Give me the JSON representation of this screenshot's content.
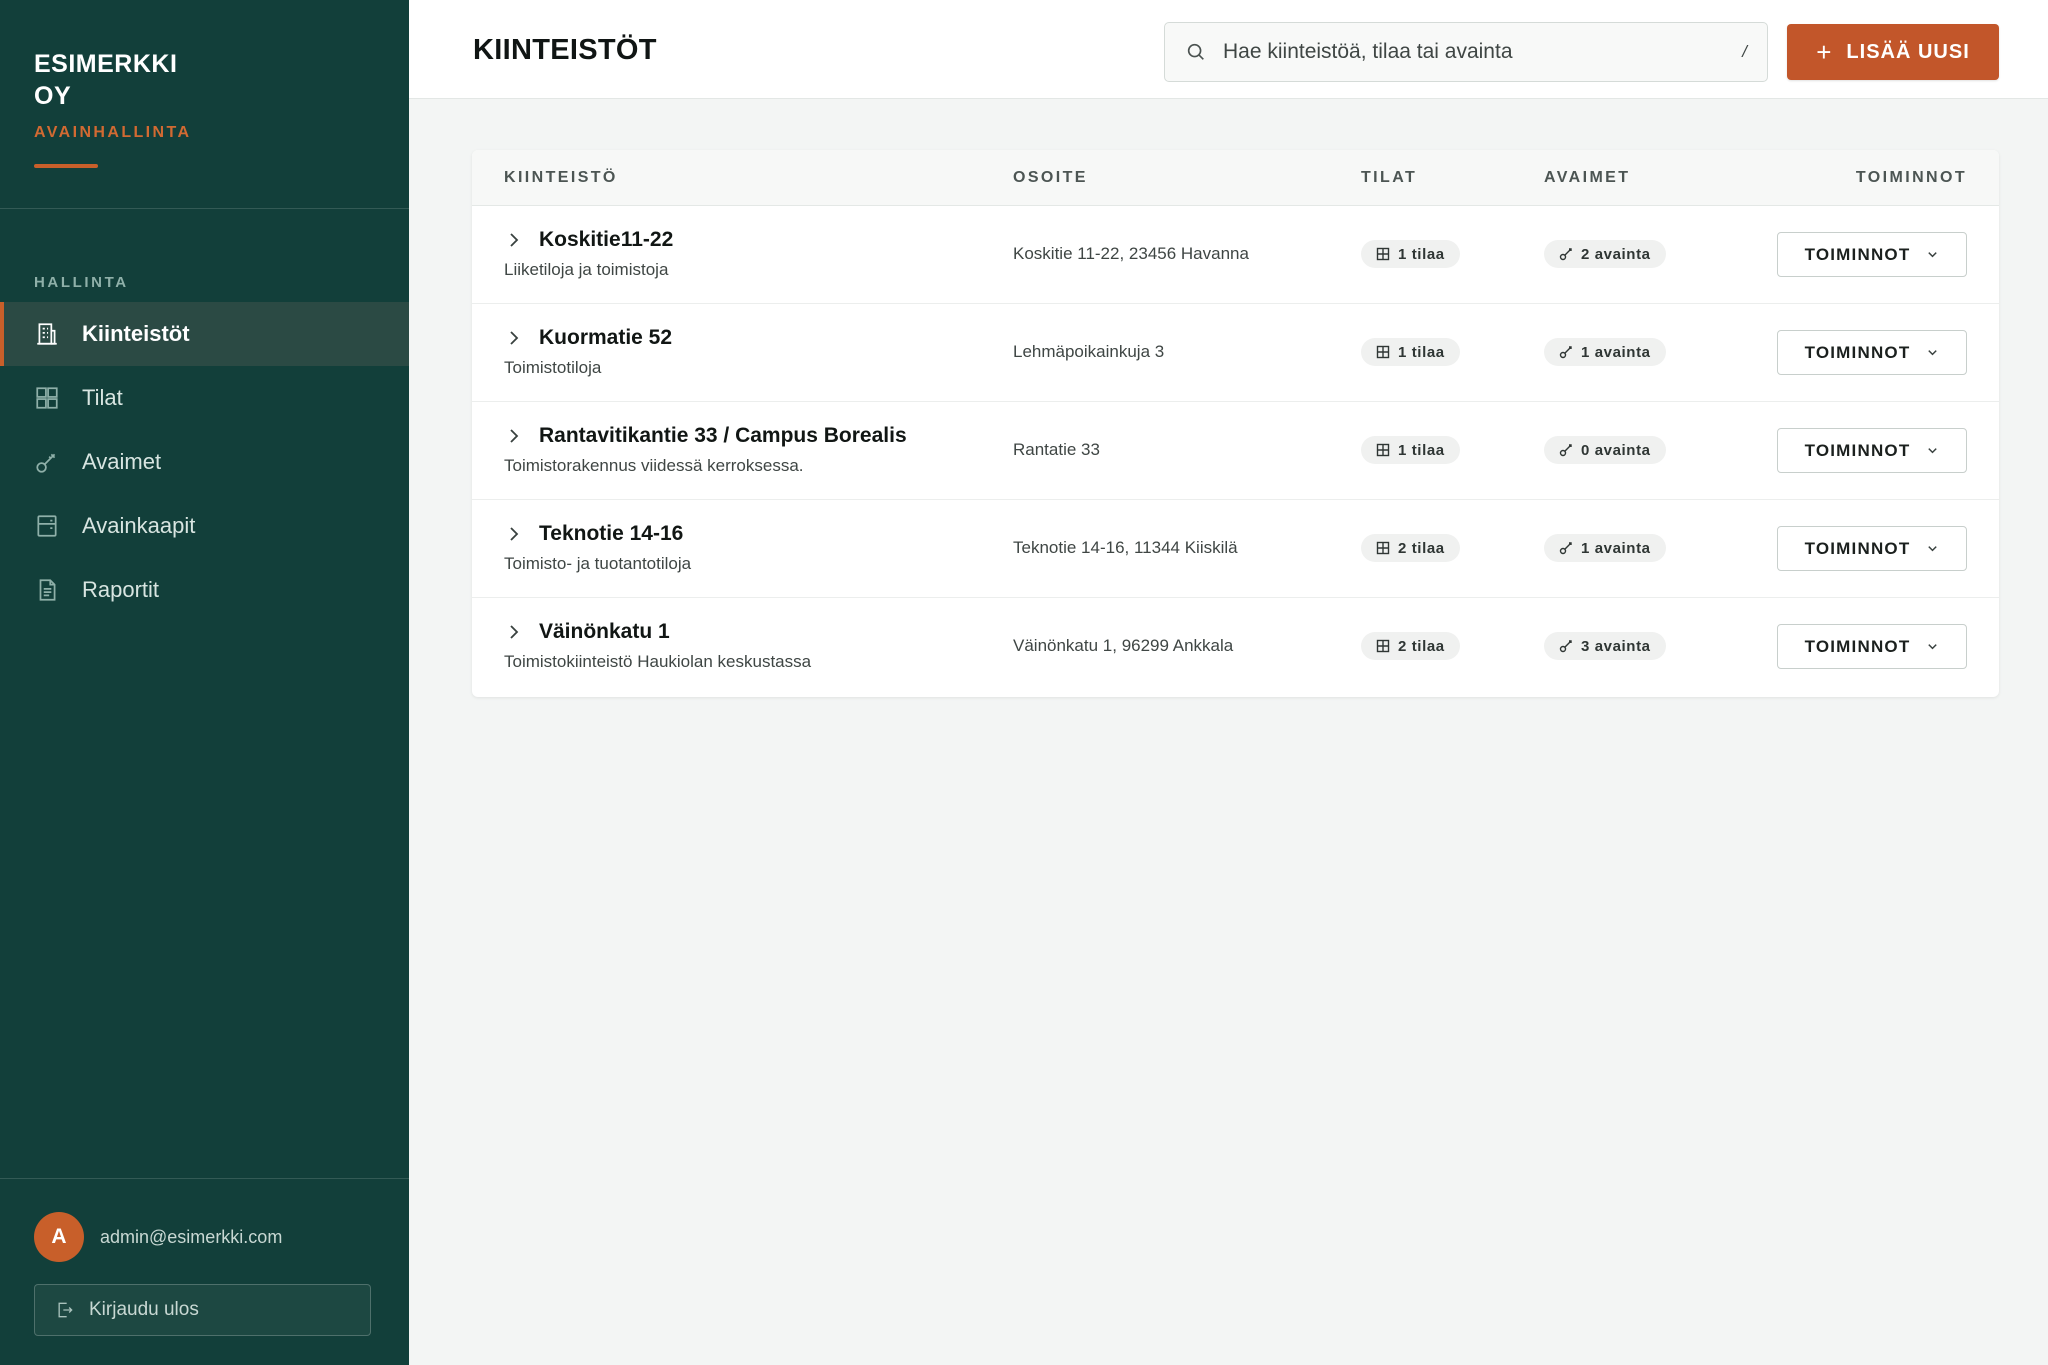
{
  "sidebar": {
    "brand_name": "ESIMERKKI OY",
    "brand_sub": "AVAINHALLINTA",
    "nav_heading": "HALLINTA",
    "items": [
      {
        "label": "Kiinteistöt",
        "icon": "building-icon",
        "active": true
      },
      {
        "label": "Tilat",
        "icon": "grid-icon",
        "active": false
      },
      {
        "label": "Avaimet",
        "icon": "key-icon",
        "active": false
      },
      {
        "label": "Avainkaapit",
        "icon": "cabinet-icon",
        "active": false
      },
      {
        "label": "Raportit",
        "icon": "document-icon",
        "active": false
      }
    ],
    "user": {
      "initial": "A",
      "email": "admin@esimerkki.com"
    },
    "logout_label": "Kirjaudu ulos"
  },
  "header": {
    "title": "KIINTEISTÖT",
    "search_placeholder": "Hae kiinteistöä, tilaa tai avainta",
    "search_shortcut": "/",
    "add_button_label": "LISÄÄ UUSI"
  },
  "table": {
    "columns": [
      "KIINTEISTÖ",
      "OSOITE",
      "TILAT",
      "AVAIMET",
      "TOIMINNOT"
    ],
    "action_label": "TOIMINNOT",
    "rows": [
      {
        "name": "Koskitie11-22",
        "description": "Liiketiloja ja toimistoja",
        "address": "Koskitie 11-22, 23456 Havanna",
        "spaces": "1 tilaa",
        "keys": "2 avainta"
      },
      {
        "name": "Kuormatie 52",
        "description": "Toimistotiloja",
        "address": "Lehmäpoikainkuja 3",
        "spaces": "1 tilaa",
        "keys": "1 avainta"
      },
      {
        "name": "Rantavitikantie 33 / Campus Borealis",
        "description": "Toimistorakennus viidessä kerroksessa.",
        "address": "Rantatie 33",
        "spaces": "1 tilaa",
        "keys": "0 avainta"
      },
      {
        "name": "Teknotie 14-16",
        "description": "Toimisto- ja tuotantotiloja",
        "address": "Teknotie 14-16, 11344 Kiiskilä",
        "spaces": "2 tilaa",
        "keys": "1 avainta"
      },
      {
        "name": "Väinönkatu 1",
        "description": "Toimistokiinteistö Haukiolan keskustassa",
        "address": "Väinönkatu 1, 96299 Ankkala",
        "spaces": "2 tilaa",
        "keys": "3 avainta"
      }
    ]
  },
  "colors": {
    "sidebar_bg": "#123f3a",
    "accent": "#c2562a",
    "page_bg": "#f3f5f4"
  }
}
